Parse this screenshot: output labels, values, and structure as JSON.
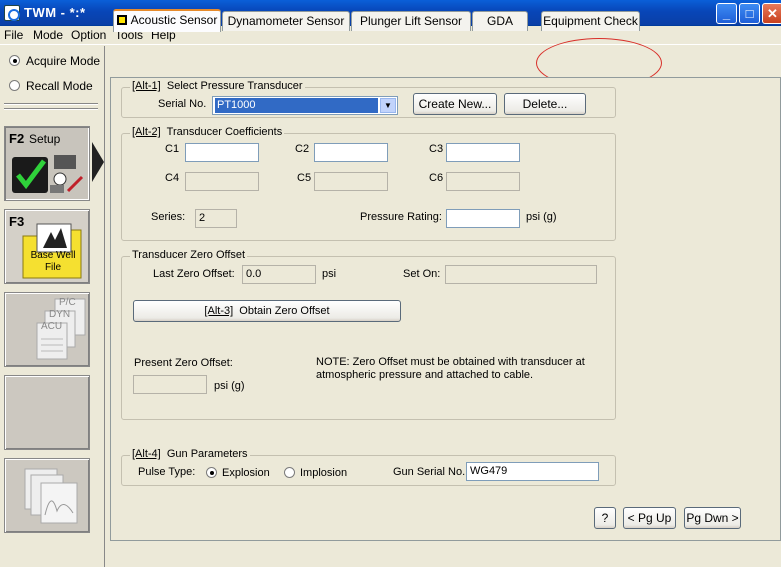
{
  "window": {
    "title": "TWM  - *:*"
  },
  "menu": {
    "file": "File",
    "mode": "Mode",
    "option": "Option",
    "tools": "Tools",
    "help": "Help"
  },
  "left": {
    "acquire_mode": "Acquire Mode",
    "recall_mode": "Recall Mode",
    "f2_key": "F2",
    "f2_label": "Setup",
    "f3_key": "F3",
    "f3_label": "Base Well File",
    "pc_labels": [
      "P/C",
      "DYN",
      "ACU"
    ]
  },
  "tabs": [
    "Acoustic Sensor",
    "Dynamometer Sensor",
    "Plunger Lift Sensor",
    "GDA",
    "Equipment Check"
  ],
  "transducer": {
    "legend_key": "[Alt-1]",
    "legend": "Select Pressure Transducer",
    "serial_label": "Serial No.",
    "serial_value": "PT1000",
    "create_new": "Create New...",
    "delete": "Delete..."
  },
  "coeffs": {
    "legend_key": "[Alt-2]",
    "legend": "Transducer Coefficients",
    "labels": [
      "C1",
      "C2",
      "C3",
      "C4",
      "C5",
      "C6"
    ],
    "series_label": "Series:",
    "series_value": "2",
    "pressure_rating_label": "Pressure Rating:",
    "psi_g": "psi (g)"
  },
  "zero_offset": {
    "legend": "Transducer Zero Offset",
    "last_label": "Last Zero Offset:",
    "last_value": "0.0",
    "psi": "psi",
    "set_on_label": "Set On:",
    "obtain_key": "[Alt-3]",
    "obtain_label": "Obtain Zero Offset",
    "present_label": "Present Zero Offset:",
    "present_unit": "psi (g)",
    "note": "NOTE:  Zero Offset must be obtained with transducer at atmospheric pressure and attached to cable."
  },
  "gun": {
    "legend_key": "[Alt-4]",
    "legend": "Gun Parameters",
    "pulse_label": "Pulse Type:",
    "explosion": "Explosion",
    "implosion": "Implosion",
    "serial_label": "Gun Serial No.",
    "serial_value": "WG479"
  },
  "footer": {
    "help": "?",
    "pgup": "< Pg Up",
    "pgdn": "Pg Dwn >"
  }
}
